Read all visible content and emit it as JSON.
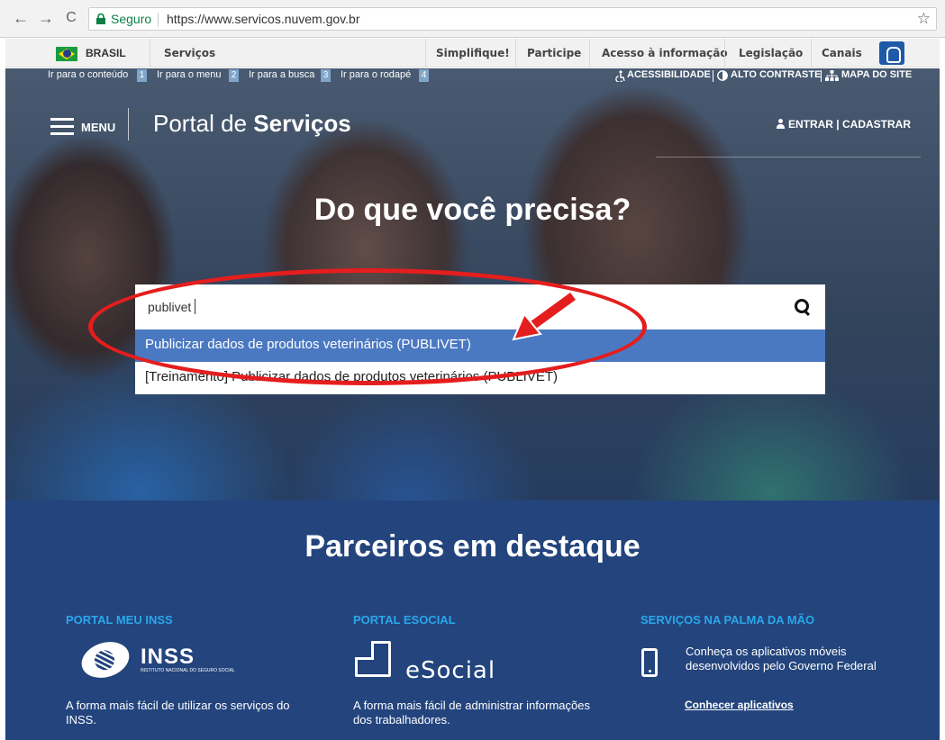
{
  "browser": {
    "back": "←",
    "forward": "→",
    "reload": "C",
    "secure_label": "Seguro",
    "url": "https://www.servicos.nuvem.gov.br",
    "bookmark": "☆"
  },
  "govbar": {
    "brasil": "BRASIL",
    "links": [
      "Serviços",
      "Simplifique!",
      "Participe",
      "Acesso à informação",
      "Legislação",
      "Canais"
    ]
  },
  "skiplinks": {
    "items": [
      {
        "label": "Ir para o conteúdo",
        "num": "1"
      },
      {
        "label": "Ir para o menu",
        "num": "2"
      },
      {
        "label": "Ir para a busca",
        "num": "3"
      },
      {
        "label": "Ir para o rodapé",
        "num": "4"
      }
    ],
    "accessibility": "ACESSIBILIDADE",
    "contrast": "ALTO CONTRASTE",
    "sitemap": "MAPA DO SITE"
  },
  "header": {
    "menu_label": "MENU",
    "portal_prefix": "Portal de ",
    "portal_bold": "Serviços",
    "login": "ENTRAR | CADASTRAR"
  },
  "hero": {
    "headline": "Do que você precisa?",
    "search_value": "publivet",
    "suggestions": [
      "Publicizar dados de produtos veterinários (PUBLIVET)",
      "[Treinamento] Publicizar dados de produtos veterinários (PUBLIVET)"
    ]
  },
  "partners": {
    "title": "Parceiros em destaque",
    "inss": {
      "title": "PORTAL MEU INSS",
      "logo_name": "INSS",
      "logo_sub": "INSTITUTO NACIONAL DO SEGURO SOCIAL",
      "text": "A forma mais fácil de utilizar os serviços do INSS."
    },
    "esocial": {
      "title": "PORTAL ESOCIAL",
      "logo_name": "eSocial",
      "text": "A forma mais fácil de administrar informações dos trabalhadores."
    },
    "apps": {
      "title": "SERVIÇOS NA PALMA DA MÃO",
      "text": "Conheça os aplicativos móveis desenvolvidos pelo Governo Federal",
      "link": "Conhecer aplicativos"
    }
  },
  "colors": {
    "partners_bg": "#23447d",
    "partner_title": "#2aa7ea",
    "suggestion_active": "#4a79c2",
    "annotation_red": "#e41e1e"
  }
}
